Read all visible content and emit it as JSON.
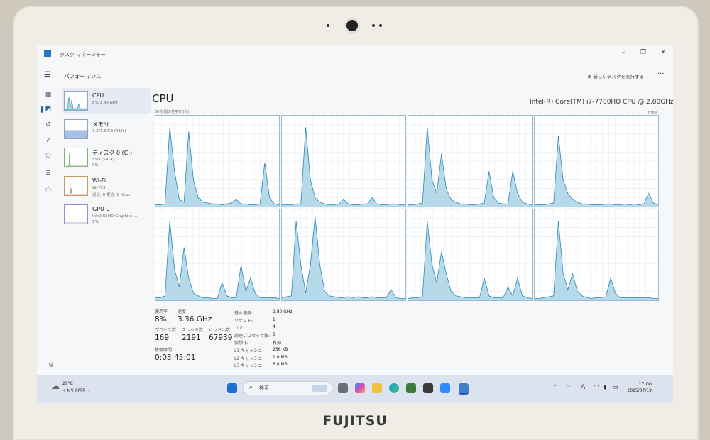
{
  "window": {
    "title": "タスク マネージャー",
    "section_title": "パフォーマンス",
    "run_task_label": "新しいタスクを実行する"
  },
  "devices": [
    {
      "name": "CPU",
      "sub": "8% 3.36 GHz",
      "sub2": ""
    },
    {
      "name": "メモリ",
      "sub": "3.2/7.8 GB (41%)",
      "sub2": ""
    },
    {
      "name": "ディスク 0 (C:)",
      "sub": "SSD (SATA)",
      "sub2": "0%"
    },
    {
      "name": "Wi-Fi",
      "sub": "Wi-Fi 3",
      "sub2": "送信: 0 受信: 0 Kbps"
    },
    {
      "name": "GPU 0",
      "sub": "Intel(R) HD Graphics ...",
      "sub2": "1%"
    }
  ],
  "cpu": {
    "title": "CPU",
    "model": "Intel(R) Core(TM) i7-7700HQ CPU @ 2.80GHz",
    "graph_caption": "60 秒間の使用率 (%)",
    "graph_max": "100%",
    "utilization_label": "使用率",
    "utilization_value": "8%",
    "speed_label": "速度",
    "speed_value": "3.36 GHz",
    "processes_label": "プロセス数",
    "processes_value": "169",
    "threads_label": "スレッド数",
    "threads_value": "2191",
    "handles_label": "ハンドル数",
    "handles_value": "67939",
    "uptime_label": "稼働時間",
    "uptime_value": "0:03:45:01",
    "specs": [
      {
        "k": "基本速度:",
        "v": "2.80 GHz"
      },
      {
        "k": "ソケット:",
        "v": "1"
      },
      {
        "k": "コア:",
        "v": "4"
      },
      {
        "k": "論理プロセッサ数:",
        "v": "8"
      },
      {
        "k": "仮想化:",
        "v": "有効"
      },
      {
        "k": "L1 キャッシュ:",
        "v": "256 KB"
      },
      {
        "k": "L2 キャッシュ:",
        "v": "1.0 MB"
      },
      {
        "k": "L3 キャッシュ:",
        "v": "6.0 MB"
      }
    ]
  },
  "chart_data": {
    "type": "area",
    "series": [
      {
        "values": [
          2,
          2,
          3,
          90,
          40,
          8,
          5,
          85,
          30,
          10,
          5,
          4,
          3,
          3,
          2,
          3,
          4,
          8,
          3,
          3,
          2,
          2,
          3,
          50,
          10,
          3,
          2
        ]
      },
      {
        "values": [
          2,
          2,
          2,
          3,
          3,
          90,
          30,
          10,
          5,
          3,
          2,
          2,
          3,
          8,
          3,
          2,
          2,
          3,
          3,
          10,
          3,
          2,
          2,
          3,
          3,
          2,
          2
        ]
      },
      {
        "values": [
          2,
          2,
          3,
          4,
          90,
          30,
          15,
          60,
          20,
          8,
          5,
          3,
          3,
          2,
          2,
          3,
          4,
          40,
          10,
          4,
          3,
          3,
          40,
          15,
          5,
          3,
          2
        ]
      },
      {
        "values": [
          2,
          2,
          2,
          3,
          4,
          80,
          30,
          15,
          8,
          5,
          3,
          3,
          2,
          2,
          2,
          3,
          3,
          2,
          2,
          3,
          2,
          3,
          2,
          3,
          15,
          4,
          2
        ]
      },
      {
        "values": [
          3,
          3,
          5,
          90,
          35,
          15,
          60,
          25,
          8,
          5,
          3,
          3,
          2,
          2,
          20,
          5,
          3,
          3,
          40,
          10,
          25,
          8,
          3,
          3,
          3,
          3,
          2
        ]
      },
      {
        "values": [
          3,
          4,
          5,
          90,
          40,
          8,
          40,
          95,
          40,
          10,
          5,
          4,
          3,
          3,
          4,
          3,
          4,
          3,
          3,
          4,
          3,
          3,
          3,
          12,
          3,
          2,
          2
        ]
      },
      {
        "values": [
          2,
          3,
          3,
          4,
          90,
          40,
          20,
          55,
          30,
          10,
          5,
          4,
          3,
          3,
          3,
          3,
          25,
          5,
          3,
          3,
          3,
          15,
          5,
          25,
          5,
          3,
          2
        ]
      },
      {
        "values": [
          2,
          2,
          3,
          4,
          5,
          90,
          30,
          12,
          30,
          10,
          5,
          3,
          2,
          3,
          3,
          4,
          25,
          8,
          3,
          3,
          3,
          3,
          3,
          3,
          3,
          2,
          2
        ]
      }
    ],
    "ylim": [
      0,
      100
    ]
  },
  "taskbar": {
    "weather_temp": "29°C",
    "weather_desc": "くもりの所多し",
    "search_placeholder": "検索",
    "time": "17:00",
    "date": "2025/07/19"
  },
  "bezel": {
    "brand": "FUJITSU"
  }
}
